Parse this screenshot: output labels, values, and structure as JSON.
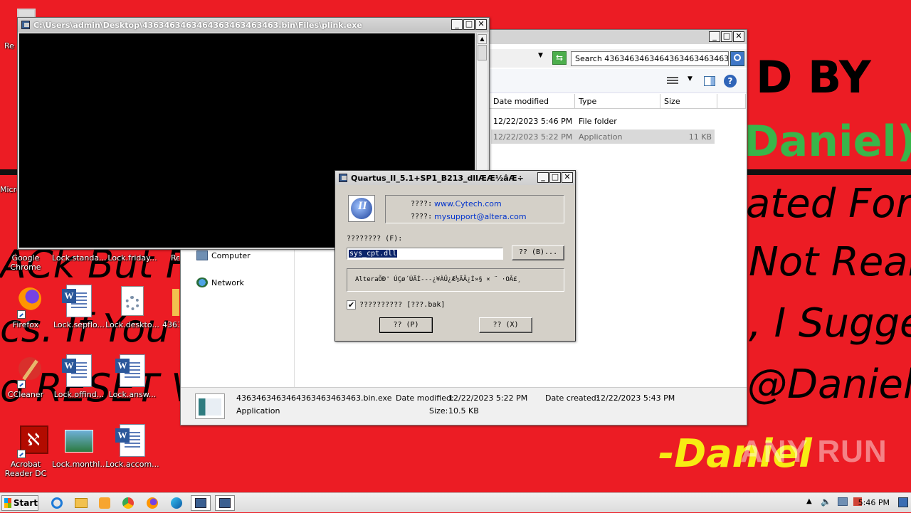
{
  "wallpaper": {
    "line1": "D BY",
    "line2": "Daniel)",
    "line3": "ated For",
    "line4": "ACk But F",
    "line5": "Not Real",
    "line6": "cs. If You",
    "line7": ", I Sugge",
    "line8": "o RESET V",
    "line9": "@Daniel",
    "line10": "-Daniel"
  },
  "desktop_icons": [
    {
      "label": "Re"
    },
    {
      "label": "Micro"
    },
    {
      "label": "Google Chrome"
    },
    {
      "label": "Lock.standa..."
    },
    {
      "label": "Lock.friday..."
    },
    {
      "label": "Re"
    },
    {
      "label": "Firefox"
    },
    {
      "label": "Lock.sepflo..."
    },
    {
      "label": "Lock.deskto..."
    },
    {
      "label": "4363"
    },
    {
      "label": "CCleaner"
    },
    {
      "label": "Lock.offind..."
    },
    {
      "label": "Lock.answ..."
    },
    {
      "label": "Acrobat Reader DC"
    },
    {
      "label": "Lock.monthl..."
    },
    {
      "label": "Lock.accom..."
    }
  ],
  "console": {
    "title": "C:\\Users\\admin\\Desktop\\4363463463464363463463463.bin\\Files\\plink.exe"
  },
  "explorer": {
    "search_placeholder": "Search 4363463463464363463463463...",
    "columns": [
      "Date modified",
      "Type",
      "Size"
    ],
    "rows": [
      {
        "date": "12/22/2023 5:46 PM",
        "type": "File folder",
        "size": ""
      },
      {
        "date": "12/22/2023 5:22 PM",
        "type": "Application",
        "size": "11 KB"
      }
    ],
    "nav": [
      "Computer",
      "Network"
    ],
    "details": {
      "filename": "4363463463464363463463463.bin.exe",
      "kind": "Application",
      "date_modified_label": "Date modified:",
      "date_modified": "12/22/2023 5:22 PM",
      "size_label": "Size:",
      "size": "10.5 KB",
      "date_created_label": "Date created:",
      "date_created": "12/22/2023 5:43 PM"
    }
  },
  "dialog": {
    "title": "Quartus_II_5.1+SP1_B213_dllÆÆ½âÆ÷",
    "web_label": "????:",
    "web_value": "www.Cytech.com",
    "email_label": "????:",
    "email_value": "mysupport@altera.com",
    "file_label": "???????? (F):",
    "file_value": "sys_cpt.dll",
    "browse_label": "?? (B)...",
    "message": "AlteraÕÐ' ÚÇø´ÚÄÍ---¿¥ÀÜ¿Æ½ÄÃ¿Í»§ × ¨ ·OÂ£¸",
    "checkbox_label": "?????????? [???.bak]",
    "ok_label": "?? (P)",
    "cancel_label": "?? (X)"
  },
  "taskbar": {
    "start_label": "Start",
    "clock": "5:46 PM"
  },
  "watermark": "ANY RUN"
}
